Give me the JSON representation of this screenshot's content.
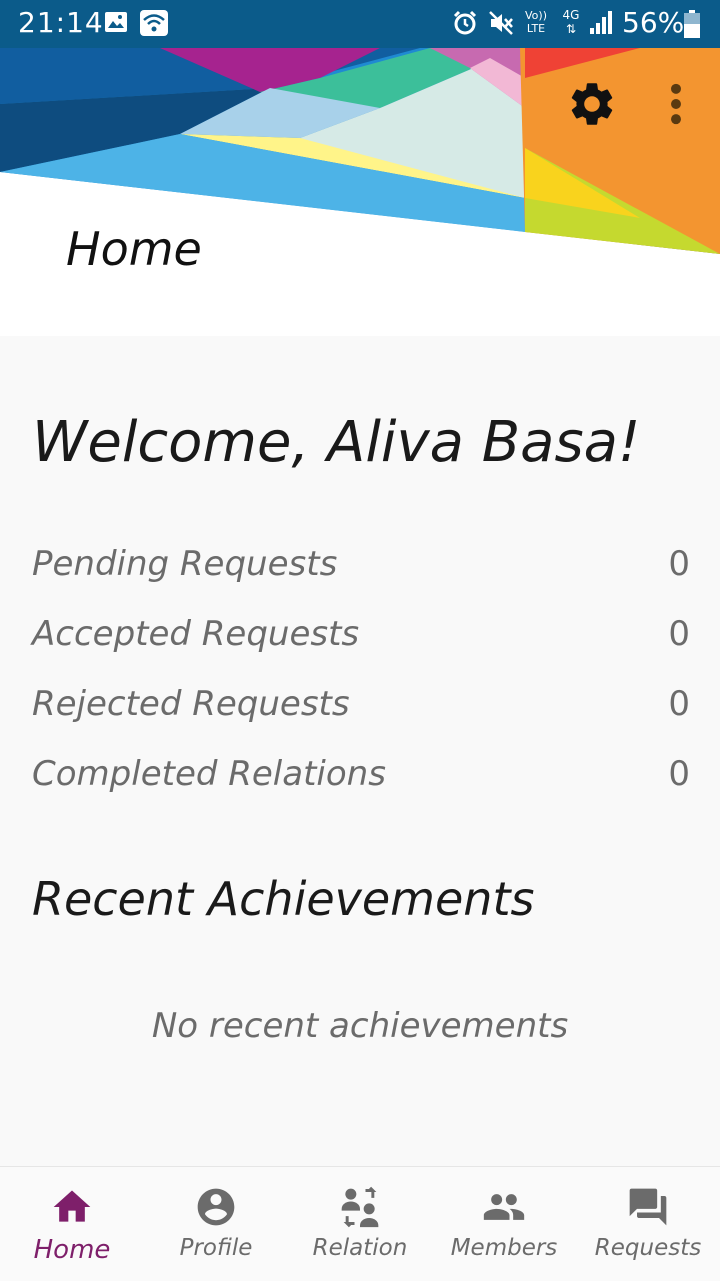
{
  "status_bar": {
    "time": "21:14",
    "battery": "56%",
    "icons": [
      "image-icon",
      "wifi-icon",
      "alarm-icon",
      "mute-icon",
      "volte-icon",
      "4g-icon",
      "signal-icon",
      "battery-icon"
    ],
    "lte_text": "Vo)) LTE",
    "net_text": "4G"
  },
  "header": {
    "title": "Home",
    "actions": [
      "gear-icon",
      "more-vert-icon"
    ]
  },
  "main": {
    "welcome": "Welcome, Aliva Basa!",
    "stats": [
      {
        "label": "Pending Requests",
        "value": "0"
      },
      {
        "label": "Accepted Requests",
        "value": "0"
      },
      {
        "label": "Rejected Requests",
        "value": "0"
      },
      {
        "label": "Completed Relations",
        "value": "0"
      }
    ],
    "achievements_title": "Recent Achievements",
    "achievements_empty": "No recent achievements"
  },
  "bottom_nav": {
    "items": [
      {
        "label": "Home",
        "icon": "home-icon",
        "active": true
      },
      {
        "label": "Profile",
        "icon": "account-circle-icon",
        "active": false
      },
      {
        "label": "Relation",
        "icon": "relation-icon",
        "active": false
      },
      {
        "label": "Members",
        "icon": "members-icon",
        "active": false
      },
      {
        "label": "Requests",
        "icon": "forum-icon",
        "active": false
      }
    ]
  },
  "colors": {
    "status_bar": "#0b5b8a",
    "active_nav": "#7e1f6a",
    "inactive_nav": "#6b6b6b"
  }
}
